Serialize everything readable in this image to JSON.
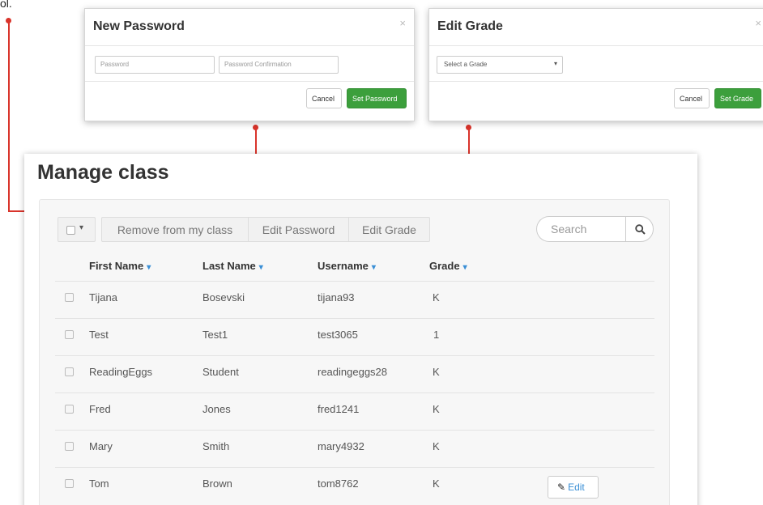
{
  "stray_text": "ol.",
  "password_modal": {
    "title": "New Password",
    "close": "×",
    "password_placeholder": "Password",
    "confirm_placeholder": "Password Confirmation",
    "cancel_label": "Cancel",
    "submit_label": "Set Password"
  },
  "grade_modal": {
    "title": "Edit Grade",
    "close": "×",
    "select_value": "Select a Grade",
    "cancel_label": "Cancel",
    "submit_label": "Set Grade"
  },
  "page": {
    "title": "Manage class"
  },
  "toolbar": {
    "remove_label": "Remove from my class",
    "edit_password_label": "Edit Password",
    "edit_grade_label": "Edit Grade",
    "search_placeholder": "Search"
  },
  "table": {
    "headers": [
      "First Name",
      "Last Name",
      "Username",
      "Grade"
    ],
    "rows": [
      {
        "first": "Tijana",
        "last": "Bosevski",
        "username": "tijana93",
        "grade": "K"
      },
      {
        "first": "Test",
        "last": "Test1",
        "username": "test3065",
        "grade": "1"
      },
      {
        "first": "ReadingEggs",
        "last": "Student",
        "username": "readingeggs28",
        "grade": "K"
      },
      {
        "first": "Fred",
        "last": "Jones",
        "username": "fred1241",
        "grade": "K"
      },
      {
        "first": "Mary",
        "last": "Smith",
        "username": "mary4932",
        "grade": "K"
      },
      {
        "first": "Tom",
        "last": "Brown",
        "username": "tom8762",
        "grade": "K"
      }
    ],
    "edit_label": "Edit"
  },
  "colors": {
    "callout_red": "#d9342b",
    "success_green": "#3c9f3c",
    "link_blue": "#3a8fd6"
  }
}
